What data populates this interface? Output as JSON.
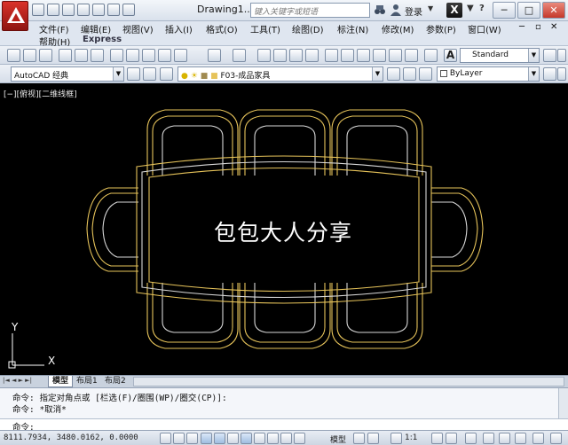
{
  "titlebar": {
    "app_letter": "A",
    "title": "Drawing1....",
    "search_placeholder": "键入关键字或短语",
    "login": "登录",
    "login_arrow": "▼",
    "x_label": "X",
    "win_min": "─",
    "win_max": "□",
    "win_close": "✕",
    "extra_down": "▼",
    "extra_help": "?"
  },
  "menubar": {
    "items": [
      "文件(F)",
      "编辑(E)",
      "视图(V)",
      "插入(I)",
      "格式(O)",
      "工具(T)",
      "绘图(D)",
      "标注(N)",
      "修改(M)",
      "参数(P)",
      "窗口(W)"
    ],
    "row2": [
      "帮助(H)",
      "Express"
    ]
  },
  "toolbar1": {
    "text_style_letter": "A",
    "text_style": "Standard"
  },
  "toolbar2": {
    "workspace": "AutoCAD 经典",
    "layer": "F03-成品家具",
    "color": "ByLayer"
  },
  "canvas": {
    "viewport_label": "[−][俯视][二维线框]",
    "watermark": "包包大人分享",
    "ucs_x": "X",
    "ucs_y": "Y"
  },
  "tabs": {
    "nav": "|◄ ◄ ► ►|",
    "items": [
      "模型",
      "布局1",
      "布局2"
    ]
  },
  "command": {
    "line1": "命令: 指定对角点或 [栏选(F)/圈围(WP)/圈交(CP)]:",
    "line2": "命令: *取消*",
    "prompt": "命令:"
  },
  "statusbar": {
    "coords": "8111.7934, 3480.0162, 0.0000",
    "model": "模型",
    "scale": "1:1"
  },
  "colors": {
    "furniture_outer": "#e6c35a",
    "furniture_inner": "#d8d8d8",
    "canvas_bg": "#000000"
  }
}
